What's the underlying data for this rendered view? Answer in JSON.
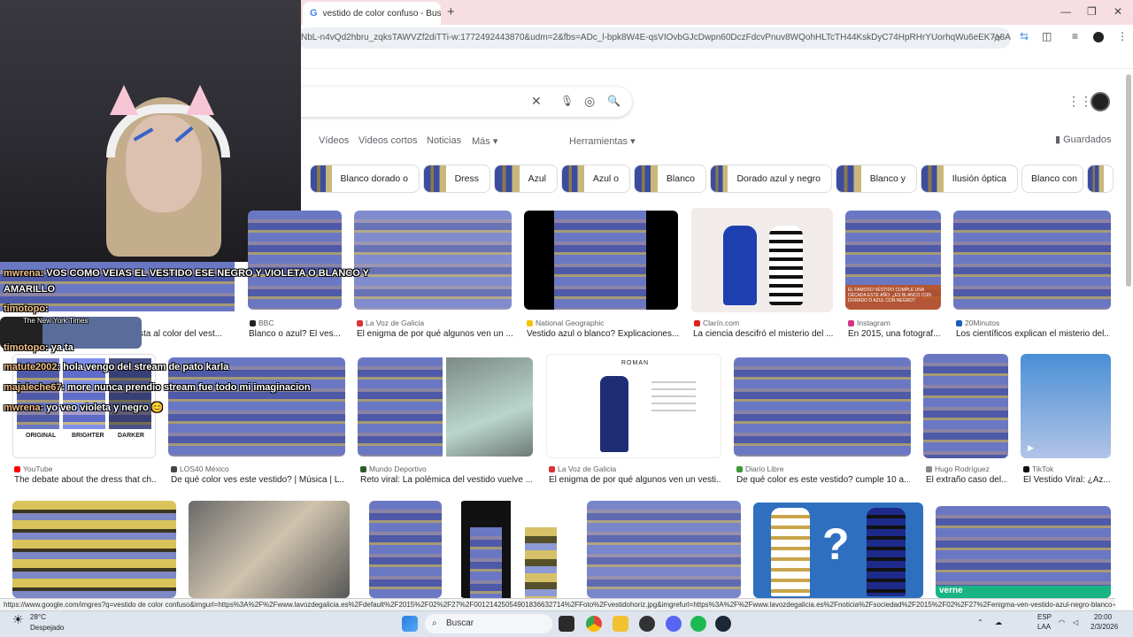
{
  "browser": {
    "tab_title": "vestido de color confuso - Busc",
    "tab_close": "×",
    "new_tab": "+",
    "url": "NbL-n4vQd2hbru_zqksTAWVZf2diTTi-w:1772492443870&udm=2&fbs=ADc_l-bpk8W4E-qsVIOvbGJcDwpn60DczFdcvPnuv8WQohHLTcTH44KskDyC74HpRHrYUorhqWu6eEK7a8AtTZp...",
    "window_controls": [
      "—",
      "❐",
      "✕"
    ]
  },
  "search": {
    "clear": "✕",
    "mic": "🎤",
    "lens": "◎",
    "search": "🔍"
  },
  "nav": {
    "items": [
      "Vídeos",
      "Videos cortos",
      "Noticias",
      "Más ▾"
    ],
    "tools": "Herramientas ▾",
    "saved": "Guardados"
  },
  "chips": [
    "Blanco dorado o",
    "Dress",
    "Azul",
    "Azul o",
    "Blanco",
    "Dorado azul y negro",
    "Blanco y",
    "Ilusión óptica",
    "Blanco con"
  ],
  "results_row1": [
    {
      "source": "BBC",
      "caption": "Blanco o azul? El ves..."
    },
    {
      "source": "La Voz de Galicia",
      "caption": "El enigma de por qué algunos ven un ..."
    },
    {
      "source": "National Geographic",
      "caption": "Vestido azul o blanco? Explicaciones..."
    },
    {
      "source": "Clarín.com",
      "caption": "La ciencia descifró el misterio del ..."
    },
    {
      "source": "Instagram",
      "caption": "En 2015, una fotograf..."
    },
    {
      "source": "20Minutos",
      "caption": "Los científicos explican el misterio del..."
    }
  ],
  "results_row1_partial": "uesta al color del vest...",
  "results_row2": [
    {
      "source": "YouTube",
      "caption": "The debate about the dress that ch..."
    },
    {
      "source": "LOS40 México",
      "caption": "De qué color ves este vestido? | Música | L..."
    },
    {
      "source": "Mundo Deportivo",
      "caption": "Reto viral: La polémica del vestido vuelve ..."
    },
    {
      "source": "La Voz de Galicia",
      "caption": "El enigma de por qué algunos ven un vesti..."
    },
    {
      "source": "Diario Libre",
      "caption": "De qué color es este vestido? cumple 10 a..."
    },
    {
      "source": "Hugo Rodríguez",
      "caption": "El extraño caso del..."
    },
    {
      "source": "TikTok",
      "caption": "El Vestido Viral: ¿Az..."
    }
  ],
  "thumb_labels": {
    "original": "ORIGINAL",
    "brighter": "BRIGHTER",
    "darker": "DARKER",
    "roman": "ROMAN",
    "verne": "verne",
    "natgeo_overlay": "EL FAMOSO VESTIDO CUMPLE UNA DÉCADA ESTE AÑO: ¿ES BLANCO CON DORADO O AZUL CON NEGRO?"
  },
  "status_url": "https://www.google.com/imgres?q=vestido de color confuso&imgurl=https%3A%2F%2Fwww.lavozdegalicia.es%2Fdefault%2F2015%2F02%2F27%2F00121425054901836632714%2FFoto%2Fvestidohoriz.jpg&imgrefurl=https%3A%2F%2Fwww.lavozdegalicia.es%2Fnoticia%2Fsociedad%2F2015%2F02%2F27%2Fenigma-ven-vestido-azul-negro-blanco-dor...",
  "chat": [
    {
      "user": "mwrena",
      "msg": ": VOS COMO VEIAS EL VESTIDO ESE NEGRO Y VIOLETA O BLANCO Y"
    },
    {
      "user": "",
      "msg": "AMARILLO"
    },
    {
      "user": "timotopo",
      "msg": ":"
    },
    {
      "user": "The New York Times",
      "msg": ""
    },
    {
      "user": "timotopo",
      "msg": ": ya ta"
    },
    {
      "user": "matute2002",
      "msg": ": hola vengo del stream de pato karla"
    },
    {
      "user": "majaleche67",
      "msg": ": more nunca prendio stream fue todo mi imaginacion"
    },
    {
      "user": "mwrena",
      "msg": ": yo veo violeta y negro 😊"
    }
  ],
  "taskbar": {
    "weather_temp": "28°C",
    "weather_desc": "Despejado",
    "search": "Buscar",
    "lang1": "ESP",
    "lang2": "LAA",
    "time": "20:00",
    "date": "2/3/2026"
  }
}
